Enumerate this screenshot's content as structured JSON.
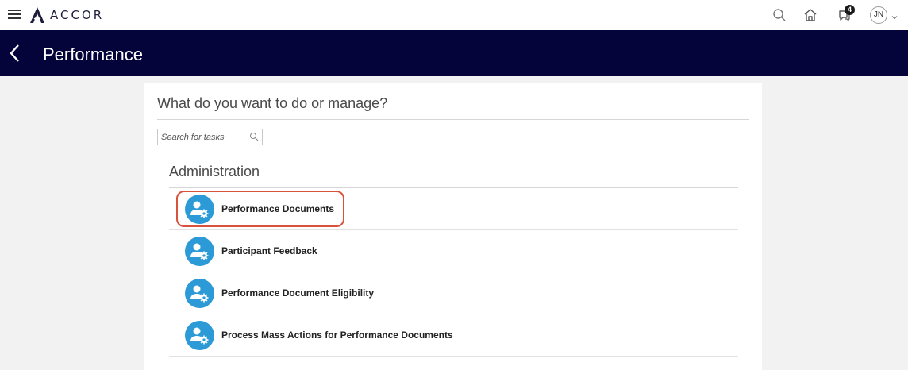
{
  "topbar": {
    "brand": "ACCOR",
    "notifications_count": "4",
    "user_initials": "JN"
  },
  "header": {
    "title": "Performance"
  },
  "panel": {
    "heading": "What do you want to do or manage?",
    "search_placeholder": "Search for tasks"
  },
  "section": {
    "title": "Administration",
    "tasks": [
      {
        "label": "Performance Documents",
        "highlighted": true
      },
      {
        "label": "Participant Feedback"
      },
      {
        "label": "Performance Document Eligibility"
      },
      {
        "label": "Process Mass Actions for Performance Documents"
      }
    ]
  },
  "colors": {
    "header_bg": "#04043a",
    "task_icon_bg": "#2b9ad6",
    "highlight_border": "#d9533c"
  },
  "icons": {
    "menu": "hamburger-icon",
    "search": "search-icon",
    "home": "home-icon",
    "notifications": "notification-icon",
    "back": "chevron-left-icon",
    "task": "user-gear-icon"
  }
}
